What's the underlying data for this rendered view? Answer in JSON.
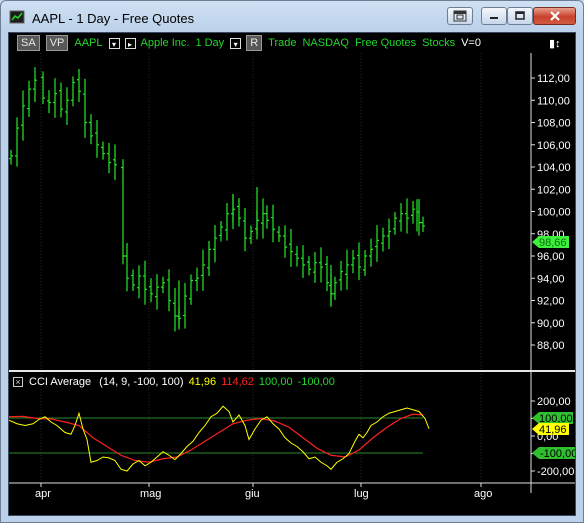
{
  "window": {
    "title": "AAPL - 1 Day - Free Quotes",
    "controls": [
      "restore-pane",
      "minimize",
      "maximize",
      "close"
    ]
  },
  "toolbar": {
    "sa": "SA",
    "vp": "VP",
    "symbol": "AAPL",
    "name": "Apple Inc.",
    "period": "1 Day",
    "r_label": "R",
    "type": "Trade",
    "exchange": "NASDAQ",
    "feed": "Free Quotes",
    "category": "Stocks",
    "volume": "V=0"
  },
  "price": {
    "last_label": "98,66",
    "accent": "#3df03d",
    "bar_color": "#25e829"
  },
  "cci": {
    "name": "CCI Average",
    "params": "(14,  9,  -100,  100)",
    "value_yellow": "41,96",
    "value_red": "114,62",
    "level_high": "100,00",
    "level_low": "-100,00",
    "tag_high": "100,00",
    "tag_value": "41,96",
    "tag_low": "-100,00",
    "color_cci": "#ffff00",
    "color_avg": "#ff2020",
    "color_levels": "#2a8a2a"
  },
  "chart_data": [
    {
      "type": "ohlc",
      "title": "AAPL - 1 Day",
      "ylim": [
        88.6,
        113.5
      ],
      "yticks": [
        "112,00",
        "110,00",
        "108,00",
        "106,00",
        "104,00",
        "102,00",
        "100,00",
        "98,00",
        "96,00",
        "94,00",
        "92,00",
        "90,00",
        "88,00"
      ],
      "xticks": [
        "apr",
        "mag",
        "giu",
        "lug",
        "ago"
      ],
      "last_value": 98.66,
      "segments": [
        {
          "period": "late Mar - mid Apr",
          "approx_range": [
            104.0,
            112.4
          ]
        },
        {
          "period": "mid Apr - early May",
          "approx_range": [
            92.5,
            98.0
          ]
        },
        {
          "period": "early May",
          "approx_range": [
            89.6,
            95.0
          ]
        },
        {
          "period": "late May - early Jun",
          "approx_range": [
            96.0,
            102.0
          ]
        },
        {
          "period": "mid Jun - late Jun",
          "approx_range": [
            91.8,
            100.0
          ]
        },
        {
          "period": "July",
          "approx_range": [
            92.5,
            101.0
          ]
        }
      ]
    },
    {
      "type": "line",
      "title": "CCI Average",
      "ylim": [
        -230,
        230
      ],
      "yticks": [
        "200,00",
        "100,00",
        "0,00",
        "-100,00",
        "-200,00"
      ],
      "series": [
        {
          "name": "CCI",
          "color": "#ffff00",
          "last": 41.96
        },
        {
          "name": "Average",
          "color": "#ff2020",
          "last": 114.62
        }
      ]
    }
  ]
}
